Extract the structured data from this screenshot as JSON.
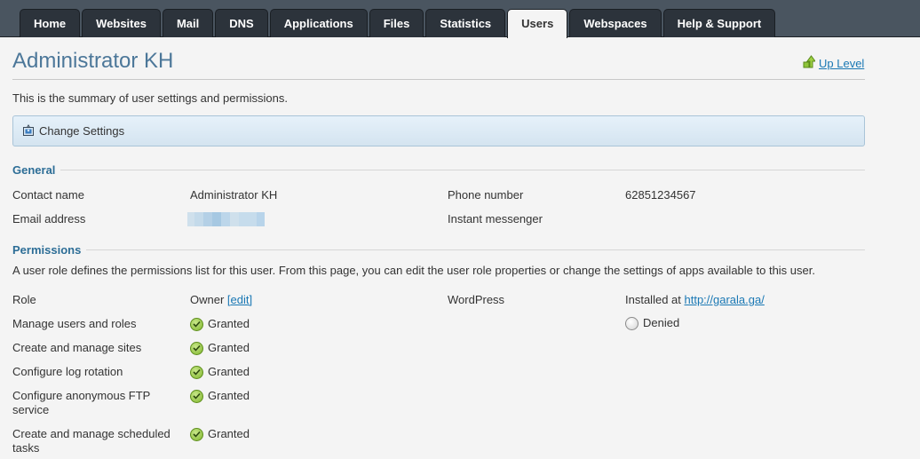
{
  "nav": {
    "tabs": [
      {
        "label": "Home",
        "active": false
      },
      {
        "label": "Websites",
        "active": false
      },
      {
        "label": "Mail",
        "active": false
      },
      {
        "label": "DNS",
        "active": false
      },
      {
        "label": "Applications",
        "active": false
      },
      {
        "label": "Files",
        "active": false
      },
      {
        "label": "Statistics",
        "active": false
      },
      {
        "label": "Users",
        "active": true
      },
      {
        "label": "Webspaces",
        "active": false
      },
      {
        "label": "Help & Support",
        "active": false
      }
    ]
  },
  "header": {
    "title": "Administrator KH",
    "up_level": "Up Level"
  },
  "summary": "This is the summary of user settings and permissions.",
  "toolbar": {
    "change_settings": "Change Settings"
  },
  "general": {
    "heading": "General",
    "contact_name_label": "Contact name",
    "contact_name_value": "Administrator KH",
    "email_label": "Email address",
    "phone_label": "Phone number",
    "phone_value": "62851234567",
    "im_label": "Instant messenger"
  },
  "permissions": {
    "heading": "Permissions",
    "description": "A user role defines the permissions list for this user. From this page, you can edit the user role properties or change the settings of apps available to this user.",
    "role_label": "Role",
    "role_value": "Owner",
    "role_edit": "[edit]",
    "items": [
      {
        "label": "Manage users and roles",
        "status": "Granted"
      },
      {
        "label": "Create and manage sites",
        "status": "Granted"
      },
      {
        "label": "Configure log rotation",
        "status": "Granted"
      },
      {
        "label": "Configure anonymous FTP service",
        "status": "Granted"
      },
      {
        "label": "Create and manage scheduled tasks",
        "status": "Granted"
      }
    ],
    "apps": [
      {
        "label": "WordPress",
        "installed_prefix": "Installed at",
        "url": "http://garala.ga/",
        "status": "Denied"
      }
    ]
  },
  "colors": {
    "accent": "#4c7799",
    "link": "#1a78b4",
    "section_heading": "#2c6d96",
    "topbar": "#4a5560"
  }
}
